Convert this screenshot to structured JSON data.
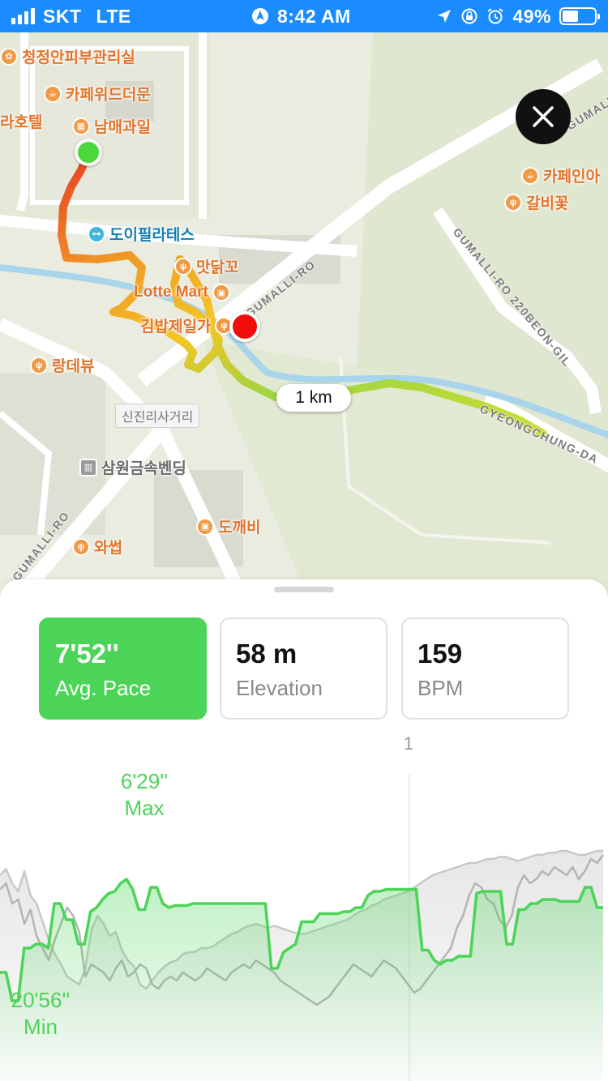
{
  "status_bar": {
    "carrier": "SKT",
    "network": "LTE",
    "time": "8:42 AM",
    "battery": "49%",
    "battery_fraction": 0.49
  },
  "map": {
    "pois": [
      {
        "name": "청정안피부관리실",
        "icon": "spa-icon",
        "kind": "orange"
      },
      {
        "name": "카페위드더문",
        "icon": "cafe-icon",
        "kind": "orange"
      },
      {
        "name": "남매과일",
        "icon": "basket-icon",
        "kind": "orange"
      },
      {
        "name": "도이필라테스",
        "icon": "dumbbell-icon",
        "kind": "teal"
      },
      {
        "name": "맛닭꼬",
        "icon": "restaurant-icon",
        "kind": "orange"
      },
      {
        "name": "Lotte Mart",
        "icon": "shopping-bag-icon",
        "kind": "orange"
      },
      {
        "name": "김밥제일가",
        "icon": "restaurant-icon",
        "kind": "orange"
      },
      {
        "name": "랑데뷰",
        "icon": "restaurant-icon",
        "kind": "orange"
      },
      {
        "name": "카페인아",
        "icon": "cafe-icon",
        "kind": "orange"
      },
      {
        "name": "갈비꽃",
        "icon": "restaurant-icon",
        "kind": "orange"
      },
      {
        "name": "삼원금속벤딩",
        "icon": "building-icon",
        "kind": "gray"
      },
      {
        "name": "도깨비",
        "icon": "shopping-bag-icon",
        "kind": "orange"
      },
      {
        "name": "와썹",
        "icon": "restaurant-icon",
        "kind": "orange"
      }
    ],
    "hotel_fragment": "라호텔",
    "roads": {
      "gumalli_ro": "GUMALLI-RO",
      "gumalli_ro_left": "GUMALLI-RO",
      "gumalli_ro_top": "GUMALLI-RO",
      "side_road": "GUMALLI-RO 220BEON-GIL",
      "gyeongchung": "GYEONGCHUNG-DA"
    },
    "junction": "신진리사거리",
    "distance_marker": "1 km"
  },
  "stats": {
    "pace": {
      "value": "7'52''",
      "label": "Avg. Pace"
    },
    "elevation": {
      "value": "58 m",
      "label": "Elevation"
    },
    "heart": {
      "value": "159",
      "label": "BPM"
    }
  },
  "chart": {
    "km_tick": "1",
    "max_value": "6'29''",
    "max_label": "Max",
    "min_value": "20'56''",
    "min_label": "Min"
  },
  "chart_data": {
    "type": "line",
    "x_label": "km",
    "x_ticks": [
      "1"
    ],
    "series": [
      {
        "metric": "pace",
        "color": "#4bd457",
        "fill": true,
        "values": [
          0.24,
          0.24,
          0.1,
          0.1,
          0.36,
          0.36,
          0.38,
          0.38,
          0.36,
          0.58,
          0.58,
          0.5,
          0.5,
          0.38,
          0.38,
          0.54,
          0.56,
          0.6,
          0.63,
          0.64,
          0.68,
          0.7,
          0.65,
          0.55,
          0.55,
          0.66,
          0.66,
          0.58,
          0.56,
          0.57,
          0.57,
          0.57,
          0.58,
          0.58,
          0.58,
          0.58,
          0.58,
          0.58,
          0.58,
          0.58,
          0.58,
          0.58,
          0.58,
          0.58,
          0.58,
          0.26,
          0.26,
          0.34,
          0.36,
          0.38,
          0.49,
          0.49,
          0.49,
          0.53,
          0.53,
          0.53,
          0.53,
          0.54,
          0.54,
          0.56,
          0.56,
          0.62,
          0.64,
          0.64,
          0.65,
          0.65,
          0.65,
          0.65,
          0.65,
          0.65,
          0.35,
          0.35,
          0.3,
          0.28,
          0.3,
          0.3,
          0.32,
          0.32,
          0.32,
          0.63,
          0.64,
          0.64,
          0.64,
          0.64,
          0.38,
          0.38,
          0.55,
          0.55,
          0.58,
          0.58,
          0.6,
          0.6,
          0.6,
          0.59,
          0.59,
          0.59,
          0.59,
          0.66,
          0.66,
          0.56,
          0.56
        ],
        "max_label": "6'29''",
        "min_label": "20'56''"
      },
      {
        "metric": "elevation",
        "color": "#c8c8c8",
        "fill": true,
        "values": [
          0.72,
          0.75,
          0.68,
          0.64,
          0.74,
          0.62,
          0.58,
          0.49,
          0.4,
          0.33,
          0.28,
          0.22,
          0.2,
          0.18,
          0.26,
          0.45,
          0.52,
          0.48,
          0.42,
          0.44,
          0.35,
          0.3,
          0.27,
          0.18,
          0.16,
          0.2,
          0.24,
          0.27,
          0.29,
          0.3,
          0.33,
          0.34,
          0.34,
          0.36,
          0.36,
          0.37,
          0.39,
          0.41,
          0.43,
          0.44,
          0.46,
          0.47,
          0.48,
          0.47,
          0.46,
          0.47,
          0.46,
          0.45,
          0.44,
          0.43,
          0.43,
          0.44,
          0.45,
          0.46,
          0.47,
          0.48,
          0.49,
          0.5,
          0.52,
          0.54,
          0.55,
          0.57,
          0.58,
          0.6,
          0.61,
          0.62,
          0.63,
          0.64,
          0.66,
          0.68,
          0.7,
          0.72,
          0.73,
          0.74,
          0.75,
          0.76,
          0.77,
          0.78,
          0.78,
          0.79,
          0.8,
          0.8,
          0.81,
          0.81,
          0.8,
          0.79,
          0.8,
          0.81,
          0.82,
          0.82,
          0.83,
          0.83,
          0.84,
          0.84,
          0.83,
          0.82,
          0.82,
          0.83,
          0.84,
          0.84
        ]
      },
      {
        "metric": "heart_rate",
        "color": "#b4b4b4",
        "fill": false,
        "values": [
          0.65,
          0.68,
          0.58,
          0.6,
          0.48,
          0.55,
          0.42,
          0.36,
          0.3,
          0.4,
          0.48,
          0.56,
          0.52,
          0.44,
          0.22,
          0.28,
          0.26,
          0.24,
          0.2,
          0.26,
          0.3,
          0.22,
          0.24,
          0.28,
          0.26,
          0.18,
          0.16,
          0.2,
          0.22,
          0.2,
          0.24,
          0.22,
          0.2,
          0.22,
          0.26,
          0.24,
          0.22,
          0.2,
          0.24,
          0.26,
          0.28,
          0.26,
          0.3,
          0.28,
          0.26,
          0.24,
          0.2,
          0.18,
          0.16,
          0.14,
          0.12,
          0.1,
          0.08,
          0.1,
          0.12,
          0.16,
          0.2,
          0.24,
          0.28,
          0.26,
          0.24,
          0.22,
          0.26,
          0.3,
          0.28,
          0.26,
          0.22,
          0.18,
          0.14,
          0.16,
          0.2,
          0.24,
          0.28,
          0.32,
          0.36,
          0.46,
          0.52,
          0.62,
          0.68,
          0.66,
          0.6,
          0.58,
          0.5,
          0.46,
          0.52,
          0.66,
          0.72,
          0.68,
          0.7,
          0.74,
          0.72,
          0.76,
          0.74,
          0.72,
          0.76,
          0.7,
          0.74,
          0.8,
          0.78,
          0.82
        ]
      }
    ]
  }
}
